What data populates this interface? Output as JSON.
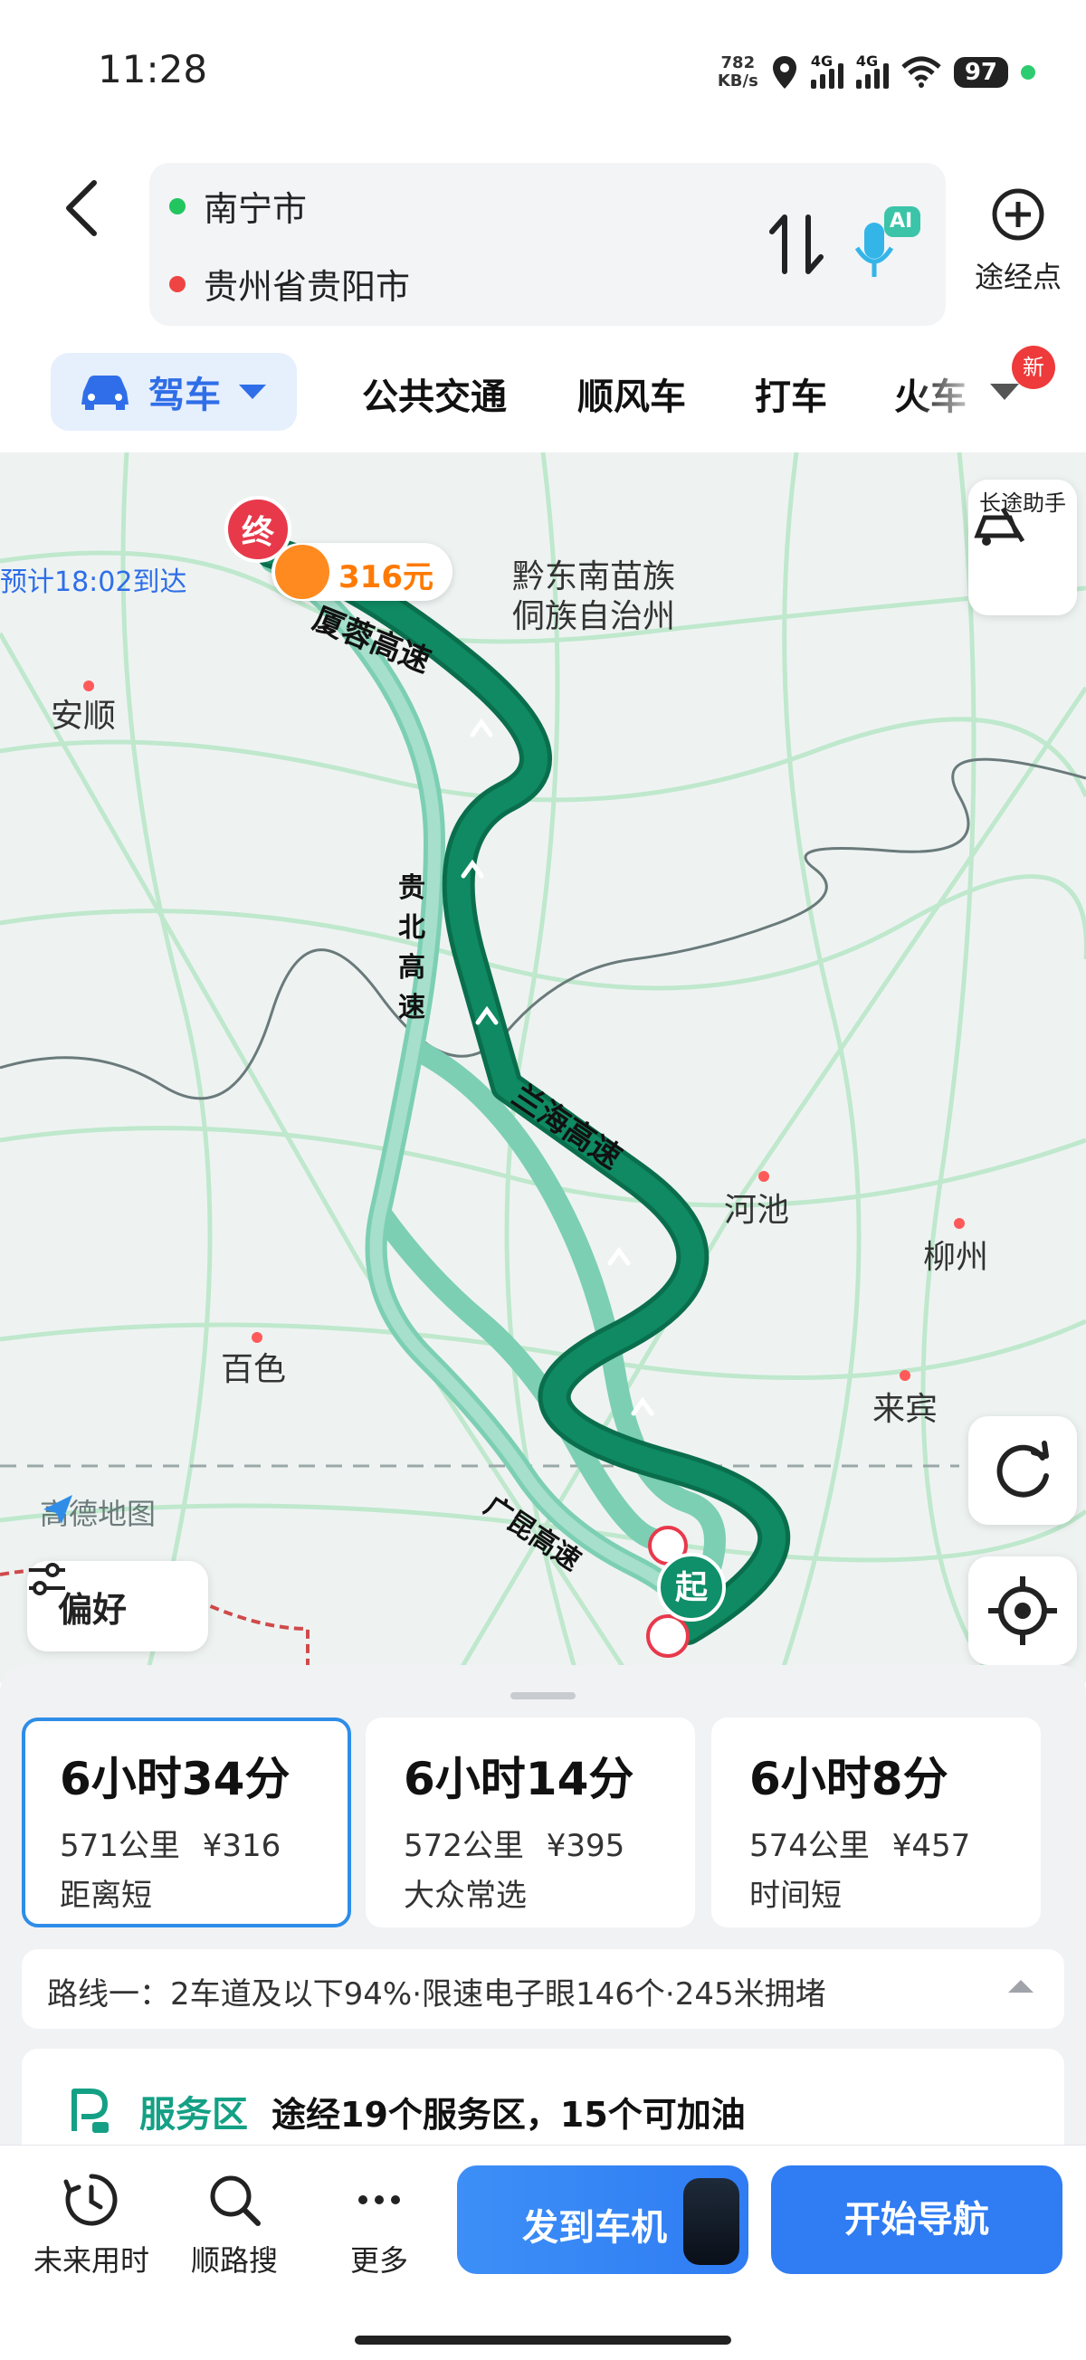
{
  "status_bar": {
    "time": "11:28",
    "net_speed_value": "782",
    "net_speed_unit": "KB/s",
    "signal1_label": "4G",
    "signal2_label": "4G",
    "battery": "97"
  },
  "route": {
    "origin": "南宁市",
    "destination": "贵州省贵阳市",
    "waypoint_label": "途经点",
    "ai_label": "AI"
  },
  "tabs": {
    "drive": "驾车",
    "transit": "公共交通",
    "carpool": "顺风车",
    "taxi": "打车",
    "train": "火车",
    "new_badge": "新"
  },
  "map": {
    "end_marker": "终",
    "start_marker": "起",
    "toll_price": "316元",
    "eta": "预计18:02到达",
    "long_trip_label": "长途助手",
    "preference_label": "偏好",
    "brand": "高德地图",
    "places": {
      "qiandongnan_1": "黔东南苗族",
      "qiandongnan_2": "侗族自治州",
      "anshun": "安顺",
      "hechi": "河池",
      "liuzhou": "柳州",
      "baise": "百色",
      "laibin": "来宾"
    },
    "roads": {
      "xiarong": "厦蓉高速",
      "guibei": "贵北高速",
      "lanhai": "兰海高速",
      "guangkun": "广昆高速"
    },
    "colors": {
      "main_route": "#0f8a62",
      "alt_route": "#7ccfb3",
      "road_grid": "#bfe8cd",
      "end_red": "#e8394b",
      "toll_orange": "#ff7a00"
    }
  },
  "routes": [
    {
      "time": "6小时34分",
      "distance": "571公里",
      "cost": "¥316",
      "tag": "距离短",
      "selected": true
    },
    {
      "time": "6小时14分",
      "distance": "572公里",
      "cost": "¥395",
      "tag": "大众常选",
      "selected": false
    },
    {
      "time": "6小时8分",
      "distance": "574公里",
      "cost": "¥457",
      "tag": "时间短",
      "selected": false
    }
  ],
  "summary": "路线一：2车道及以下94%·限速电子眼146个·245米拥堵",
  "service": {
    "tag": "服务区",
    "text": "途经19个服务区，15个可加油"
  },
  "toolbar": {
    "future_time": "未来用时",
    "along_search": "顺路搜",
    "more": "更多",
    "send_to_car": "发到车机",
    "start_nav": "开始导航"
  }
}
